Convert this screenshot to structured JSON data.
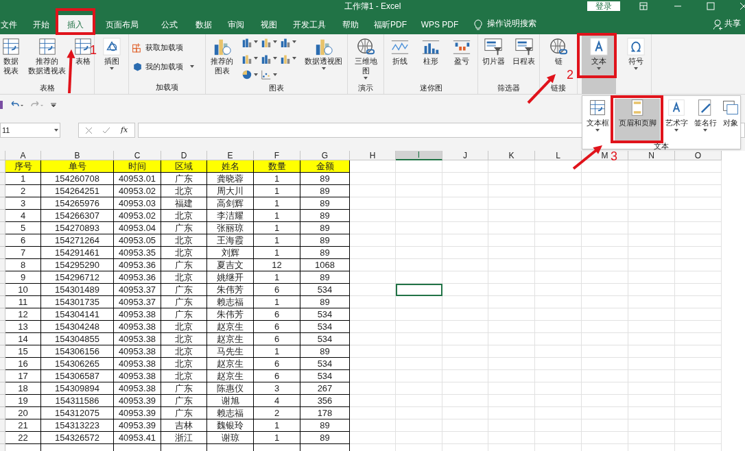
{
  "window": {
    "title": "工作簿1 - Excel",
    "login": "登录"
  },
  "tabs": [
    {
      "label": "文件",
      "selected": false
    },
    {
      "label": "开始",
      "selected": false
    },
    {
      "label": "插入",
      "selected": true
    },
    {
      "label": "页面布局",
      "selected": false
    },
    {
      "label": "公式",
      "selected": false
    },
    {
      "label": "数据",
      "selected": false
    },
    {
      "label": "审阅",
      "selected": false
    },
    {
      "label": "视图",
      "selected": false
    },
    {
      "label": "开发工具",
      "selected": false
    },
    {
      "label": "帮助",
      "selected": false
    },
    {
      "label": "福昕PDF",
      "selected": false
    },
    {
      "label": "WPS PDF",
      "selected": false
    }
  ],
  "search": "操作说明搜索",
  "share": "共享",
  "ribbon": [
    {
      "label": "表格",
      "buttons": [
        {
          "kind": "large",
          "lines": [
            "数据",
            "视表"
          ]
        },
        {
          "kind": "large",
          "lines": [
            "推荐的",
            "数据透视表"
          ]
        },
        {
          "kind": "large",
          "lines": [
            "表格"
          ]
        }
      ]
    },
    {
      "buttons": [
        {
          "kind": "large",
          "lines": [
            "插图"
          ],
          "dropdown": true
        }
      ]
    },
    {
      "label": "加载项",
      "buttons": [
        {
          "kind": "small",
          "lines": [
            "获取加载项"
          ]
        },
        {
          "kind": "small",
          "lines": [
            "我的加载项"
          ],
          "dropdown": true
        }
      ]
    },
    {
      "label": "图表",
      "buttons": [
        {
          "kind": "large",
          "lines": [
            "推荐的",
            "图表"
          ]
        },
        {
          "kind": "grid"
        },
        {
          "kind": "large",
          "lines": [
            "数据透视图"
          ],
          "dropdown": true
        }
      ]
    },
    {
      "label": "演示",
      "buttons": [
        {
          "kind": "large",
          "lines": [
            "三维地",
            "图"
          ],
          "dropdown": true
        }
      ]
    },
    {
      "label": "迷你图",
      "buttons": [
        {
          "kind": "large",
          "lines": [
            "折线"
          ]
        },
        {
          "kind": "large",
          "lines": [
            "柱形"
          ]
        },
        {
          "kind": "large",
          "lines": [
            "盈亏"
          ]
        }
      ]
    },
    {
      "label": "筛选器",
      "buttons": [
        {
          "kind": "large",
          "lines": [
            "切片器"
          ]
        },
        {
          "kind": "large",
          "lines": [
            "日程表"
          ]
        }
      ]
    },
    {
      "label": "链接",
      "buttons": [
        {
          "kind": "large",
          "lines": [
            "链"
          ]
        }
      ]
    },
    {
      "buttons": [
        {
          "kind": "large",
          "lines": [
            "文本"
          ],
          "dropdown": true,
          "pressed": true
        },
        {
          "kind": "large",
          "lines": [
            "符号"
          ],
          "dropdown": true,
          "pressed": false
        }
      ]
    }
  ],
  "popup": {
    "label": "文本",
    "items": [
      {
        "label": "文本框",
        "dropdown": true,
        "selected": false
      },
      {
        "label": "页眉和页脚",
        "dropdown": false,
        "selected": true
      },
      {
        "label": "艺术字",
        "dropdown": true,
        "selected": false
      },
      {
        "label": "签名行",
        "dropdown": true,
        "selected": false
      },
      {
        "label": "对象",
        "dropdown": false,
        "selected": false
      }
    ]
  },
  "formula_bar": {
    "name_box": "11",
    "function_button": "fx"
  },
  "columns": [
    {
      "label": "A",
      "selected": false
    },
    {
      "label": "B",
      "selected": false
    },
    {
      "label": "C",
      "selected": false
    },
    {
      "label": "D",
      "selected": false
    },
    {
      "label": "E",
      "selected": false
    },
    {
      "label": "F",
      "selected": false
    },
    {
      "label": "G",
      "selected": false
    },
    {
      "label": "H",
      "selected": false
    },
    {
      "label": "I",
      "selected": true
    },
    {
      "label": "J",
      "selected": false
    },
    {
      "label": "K",
      "selected": false
    },
    {
      "label": "L",
      "selected": false
    },
    {
      "label": "M",
      "selected": false
    },
    {
      "label": "N",
      "selected": false
    },
    {
      "label": "O",
      "selected": false
    }
  ],
  "header": [
    "序号",
    "单号",
    "时间",
    "区域",
    "姓名",
    "数量",
    "金额"
  ],
  "rows": [
    {
      "cells": [
        "1",
        "154260708",
        "40953.01",
        "广东",
        "龚晓蓉",
        "1",
        "89"
      ],
      "selected": false
    },
    {
      "cells": [
        "2",
        "154264251",
        "40953.02",
        "北京",
        "周大川",
        "1",
        "89"
      ],
      "selected": false
    },
    {
      "cells": [
        "3",
        "154265976",
        "40953.03",
        "福建",
        "高剑辉",
        "1",
        "89"
      ],
      "selected": false
    },
    {
      "cells": [
        "4",
        "154266307",
        "40953.02",
        "北京",
        "李洁耀",
        "1",
        "89"
      ],
      "selected": false
    },
    {
      "cells": [
        "5",
        "154270893",
        "40953.04",
        "广东",
        "张丽琼",
        "1",
        "89"
      ],
      "selected": false
    },
    {
      "cells": [
        "6",
        "154271264",
        "40953.05",
        "北京",
        "王海霞",
        "1",
        "89"
      ],
      "selected": false
    },
    {
      "cells": [
        "7",
        "154291461",
        "40953.35",
        "北京",
        "刘辉",
        "1",
        "89"
      ],
      "selected": false
    },
    {
      "cells": [
        "8",
        "154295290",
        "40953.36",
        "广东",
        "夏吉文",
        "12",
        "1068"
      ],
      "selected": false
    },
    {
      "cells": [
        "9",
        "154296712",
        "40953.36",
        "北京",
        "姚继开",
        "1",
        "89"
      ],
      "selected": false
    },
    {
      "cells": [
        "10",
        "154301489",
        "40953.37",
        "广东",
        "朱伟芳",
        "6",
        "534"
      ],
      "selected": true
    },
    {
      "cells": [
        "11",
        "154301735",
        "40953.37",
        "广东",
        "赖志福",
        "1",
        "89"
      ],
      "selected": false
    },
    {
      "cells": [
        "12",
        "154304141",
        "40953.38",
        "广东",
        "朱伟芳",
        "6",
        "534"
      ],
      "selected": false
    },
    {
      "cells": [
        "13",
        "154304248",
        "40953.38",
        "北京",
        "赵京生",
        "6",
        "534"
      ],
      "selected": false
    },
    {
      "cells": [
        "14",
        "154304855",
        "40953.38",
        "北京",
        "赵京生",
        "6",
        "534"
      ],
      "selected": false
    },
    {
      "cells": [
        "15",
        "154306156",
        "40953.38",
        "北京",
        "马先生",
        "1",
        "89"
      ],
      "selected": false
    },
    {
      "cells": [
        "16",
        "154306265",
        "40953.38",
        "北京",
        "赵京生",
        "6",
        "534"
      ],
      "selected": false
    },
    {
      "cells": [
        "17",
        "154306587",
        "40953.38",
        "北京",
        "赵京生",
        "6",
        "534"
      ],
      "selected": false
    },
    {
      "cells": [
        "18",
        "154309894",
        "40953.38",
        "广东",
        "陈惠仪",
        "3",
        "267"
      ],
      "selected": false
    },
    {
      "cells": [
        "19",
        "154311586",
        "40953.39",
        "广东",
        "谢旭",
        "4",
        "356"
      ],
      "selected": false
    },
    {
      "cells": [
        "20",
        "154312075",
        "40953.39",
        "广东",
        "赖志福",
        "2",
        "178"
      ],
      "selected": false
    },
    {
      "cells": [
        "21",
        "154313223",
        "40953.39",
        "吉林",
        "魏银玲",
        "1",
        "89"
      ],
      "selected": false
    },
    {
      "cells": [
        "22",
        "154326572",
        "40953.41",
        "浙江",
        "谢琼",
        "1",
        "89"
      ],
      "selected": false
    }
  ],
  "annotations": [
    {
      "number": "1"
    },
    {
      "number": "2"
    },
    {
      "number": "3"
    }
  ]
}
